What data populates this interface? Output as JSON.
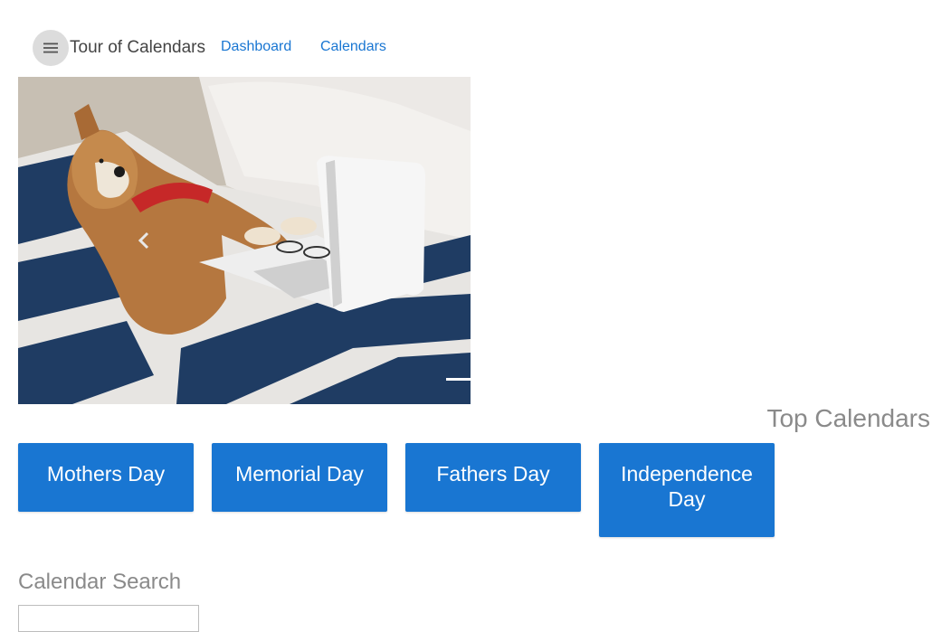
{
  "header": {
    "menu_icon": "menu-icon",
    "app_title": "Tour of Calendars",
    "nav": [
      {
        "label": "Dashboard"
      },
      {
        "label": "Calendars"
      }
    ]
  },
  "carousel": {
    "image_description_icon": "dog-laptop-photo",
    "prev_icon": "chevron-left-icon",
    "active_slide": 1
  },
  "top_calendars": {
    "heading": "Top Calendars",
    "items": [
      {
        "label": "Mothers Day"
      },
      {
        "label": "Memorial Day"
      },
      {
        "label": "Fathers Day"
      },
      {
        "label": "Independence Day"
      }
    ]
  },
  "search": {
    "heading": "Calendar Search",
    "value": "",
    "placeholder": ""
  },
  "colors": {
    "primary": "#1976d2",
    "menu_button_bg": "#dcdcdc",
    "heading_gray": "#8a8a8a"
  }
}
